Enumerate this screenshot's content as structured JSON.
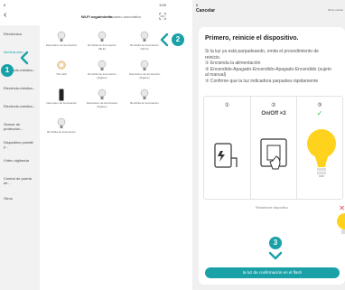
{
  "phone1": {
    "status": {
      "time": "8",
      "right": "3:59"
    },
    "tabs": {
      "active": "Wi-Fi seguimiento",
      "inactive": "Escaneo automático"
    },
    "sidebar": {
      "items": [
        {
          "label": "Electrónica",
          "active": false
        },
        {
          "label": "Ilumina-ción",
          "active": true
        },
        {
          "label": "Electrodo-méstico...",
          "active": false
        },
        {
          "label": "Electrodo-méstico...",
          "active": false
        },
        {
          "label": "Electrodo-méstico...",
          "active": false
        },
        {
          "label": "Sensor de protección...",
          "active": false
        },
        {
          "label": "Dispositivo portátil y...",
          "active": false
        },
        {
          "label": "Vídeo vigilancia",
          "active": false
        },
        {
          "label": "Control de puerta de...",
          "active": false
        },
        {
          "label": "Otros",
          "active": false
        }
      ]
    },
    "devices": [
      {
        "label": "Dispositivo de iluminación",
        "icon": "bulb-icon"
      },
      {
        "label": "Bombilla de iluminación (BLE)",
        "icon": "bulb-icon"
      },
      {
        "label": "Bombilla de iluminación (Wi-Fi)",
        "icon": "bulb-icon"
      },
      {
        "label": "Tira LED",
        "icon": "light-strip-icon"
      },
      {
        "label": "Bombilla de iluminación (Zigbee)",
        "icon": "bulb-icon"
      },
      {
        "label": "Dispositivo de iluminación (Zigbee)",
        "icon": "bulb-icon"
      },
      {
        "label": "Interruptor de iluminación",
        "icon": "switch-icon"
      },
      {
        "label": "Dispositivo de iluminación (Zigbee)",
        "icon": "bulb-icon"
      },
      {
        "label": "Bombilla de iluminación",
        "icon": "bulb-icon"
      },
      {
        "label": "Bombilla de iluminación",
        "icon": "bulb-icon"
      }
    ]
  },
  "phone2": {
    "status": "8",
    "cancel_label": "Cancelar",
    "header_right": "Otros modos",
    "card": {
      "title": "Primero, reinicie el dispositivo.",
      "lines": [
        "Si la luz ya está parpadeando, omita el procedimiento de",
        "reinicio.",
        "① Encienda la alimentación",
        "② Encendido-Apagado-Encendido-Apagado-Encendido (sujeto",
        "al manual)",
        "③ Confirme que la luz indicadora parpadea rápidamente"
      ],
      "steps": [
        {
          "num": "①",
          "caption": ""
        },
        {
          "num": "②",
          "caption": "On/Off ×3"
        },
        {
          "num": "③",
          "caption": ""
        }
      ],
      "check_symbol": "✓",
      "x_symbol": "✕",
      "note": "Restablecer dispositivo",
      "confirm_label": "la luz de confirmación en el flash"
    }
  },
  "callouts": [
    "1",
    "2",
    "3"
  ],
  "colors": {
    "accent": "#1aa1a8",
    "bulb": "#ffd21e",
    "check": "#2fbf4a",
    "error": "#e04848"
  }
}
